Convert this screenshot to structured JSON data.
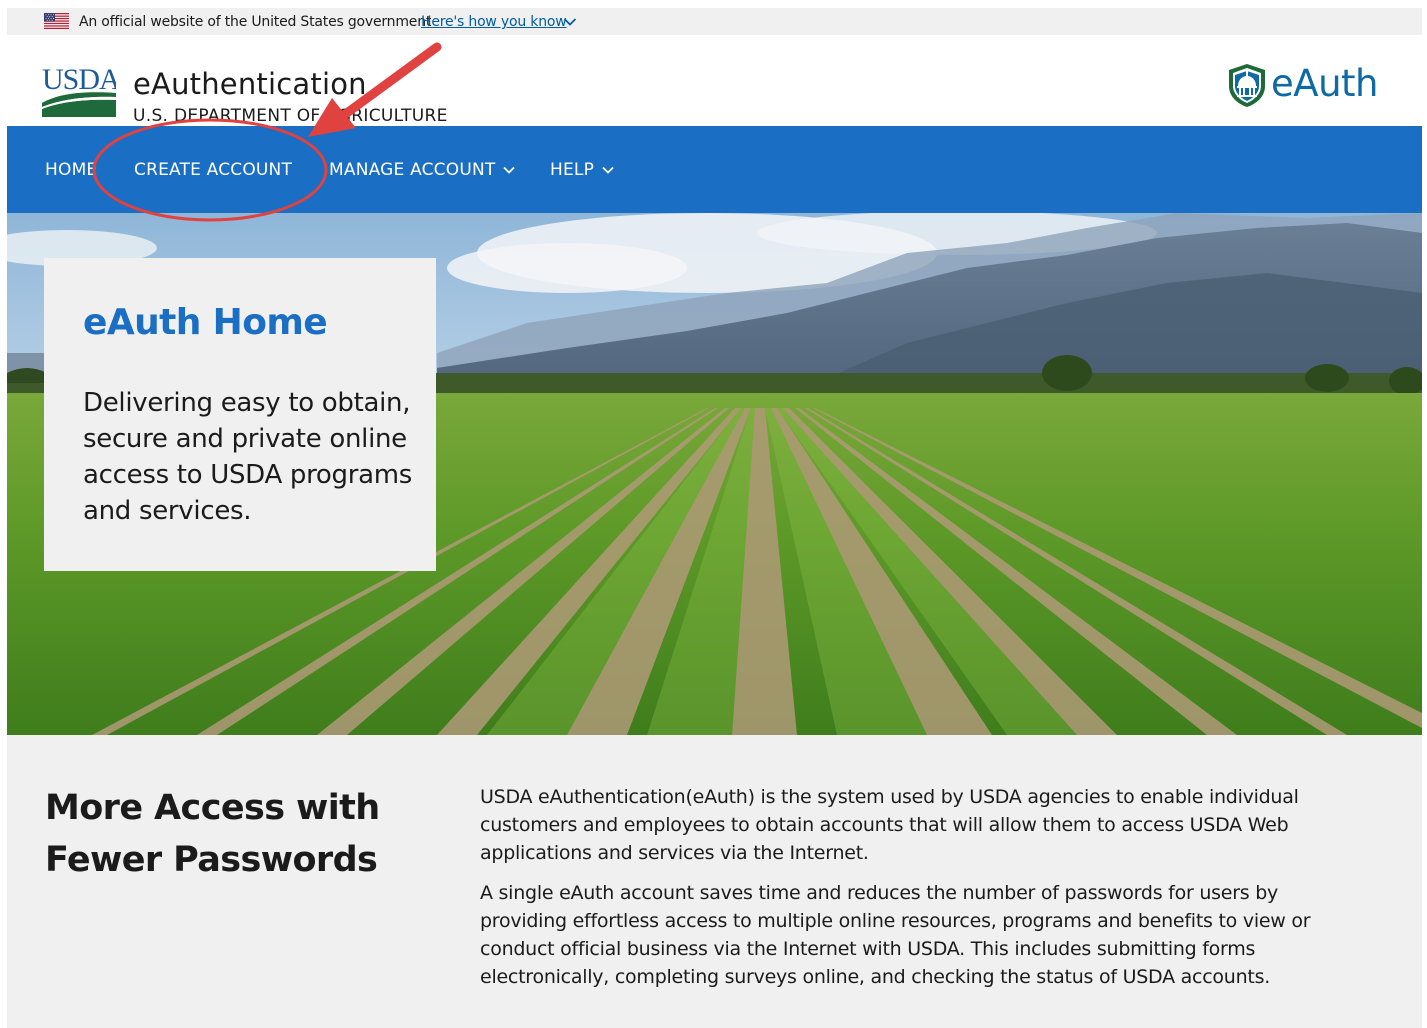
{
  "gov_banner": {
    "text": "An official website of the United States government",
    "link": "Here's how you know",
    "flag_icon": "us-flag-icon",
    "chevron_icon": "chevron-down-icon"
  },
  "header": {
    "logo_text": "USDA",
    "title": "eAuthentication",
    "subtitle": "U.S. DEPARTMENT OF AGRICULTURE",
    "eauth_logo_text": "eAuth",
    "eauth_logo_icon": "capitol-shield-icon"
  },
  "nav": {
    "items": [
      {
        "label": "HOME",
        "has_dropdown": false
      },
      {
        "label": "CREATE ACCOUNT",
        "has_dropdown": false
      },
      {
        "label": "MANAGE ACCOUNT",
        "has_dropdown": true
      },
      {
        "label": "HELP",
        "has_dropdown": true
      }
    ]
  },
  "hero": {
    "title": "eAuth Home",
    "description": "Delivering easy to obtain, secure and private online access to USDA programs and services."
  },
  "info": {
    "heading": "More Access with Fewer Passwords",
    "paragraphs": [
      "USDA eAuthentication(eAuth) is the system used by USDA agencies to enable individual customers and employees to obtain accounts that will allow them to access USDA Web applications and services via the Internet.",
      "A single eAuth account saves time and reduces the number of passwords for users by providing effortless access to multiple online resources, programs and benefits to view or conduct official business via the Internet with USDA. This includes submitting forms electronically, completing surveys online, and checking the status of USDA accounts."
    ]
  },
  "colors": {
    "nav_blue": "#1a6ec4",
    "title_blue": "#1a6ec4",
    "link_blue": "#005ea2",
    "usda_green": "#1f6a3b",
    "annotation_red": "#e0423f",
    "panel_gray": "#f0f0f0"
  }
}
